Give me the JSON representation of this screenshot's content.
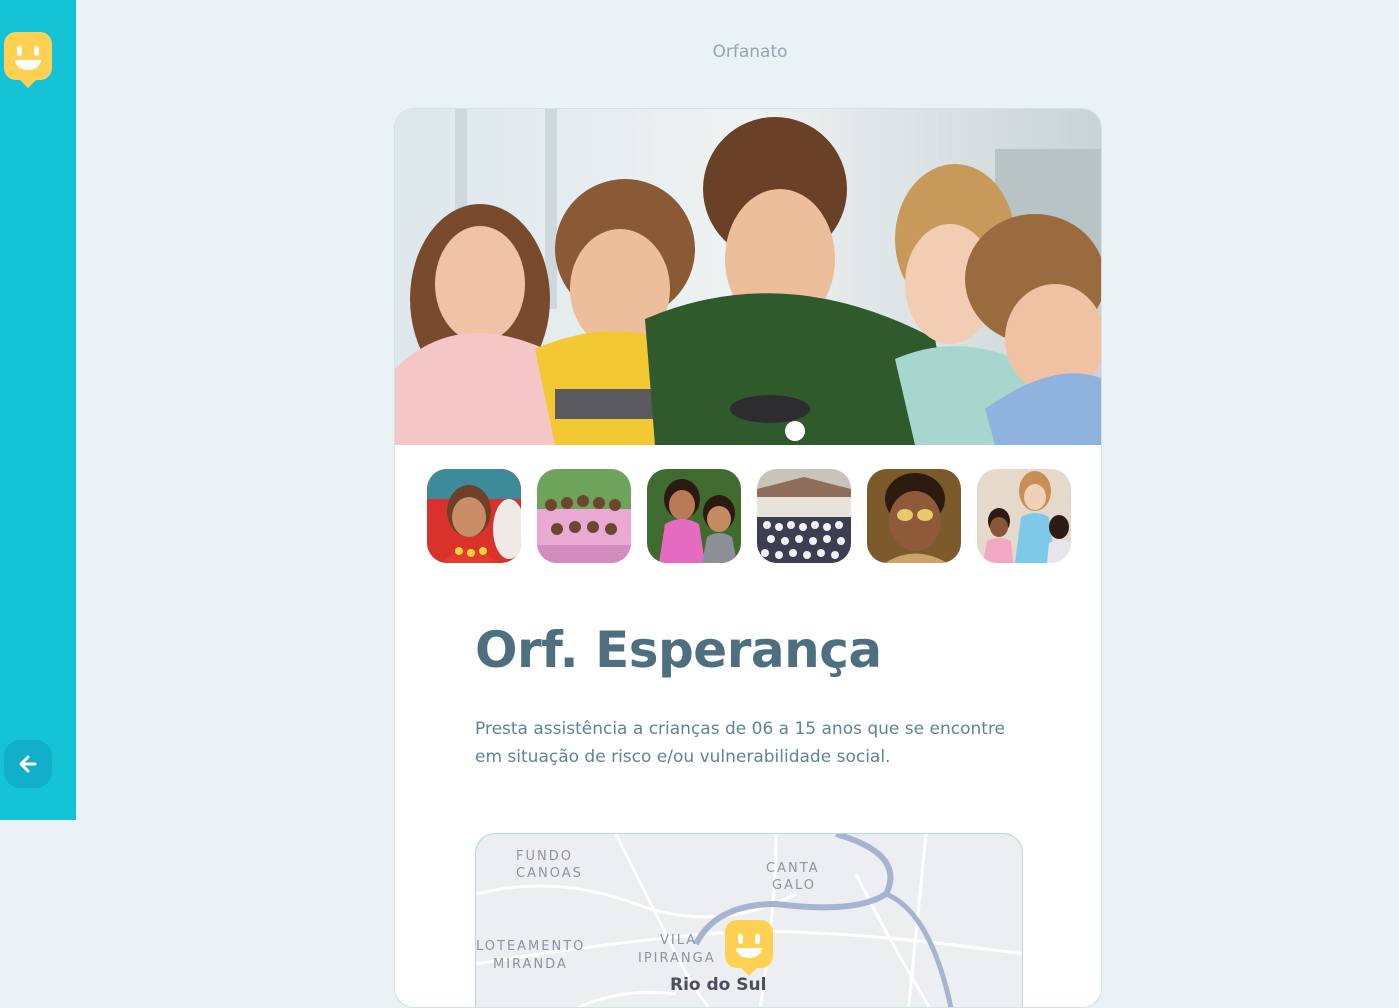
{
  "header": {
    "title": "Orfanato"
  },
  "sidebar": {
    "logo_icon": "happy-face-marker-icon",
    "back_icon": "arrow-left-icon"
  },
  "orphanage": {
    "name": "Orf. Esperança",
    "description": "Presta assistência a crianças de 06 a 15 anos que se encontre em situação de risco e/ou vulnerabilidade social."
  },
  "images": {
    "thumbnail_count": 6
  },
  "map": {
    "labels": [
      "FUNDO",
      "CANOAS",
      "CANTA",
      "GALO",
      "LOTEAMENTO",
      "MIRANDA",
      "VILA",
      "IPIRANGA",
      "Rio do Sul"
    ]
  },
  "colors": {
    "sidebar": "#15C3D6",
    "back_button": "#12AFCB",
    "title_text": "#4D6F80",
    "body_text": "#5C8599",
    "marker": "#FFD666",
    "background": "#EBF2F5"
  }
}
